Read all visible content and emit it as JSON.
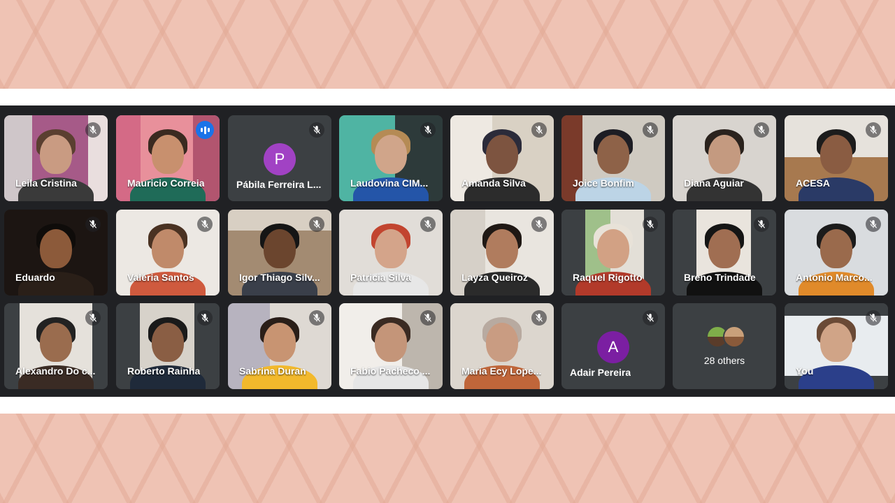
{
  "others_label": "28 others",
  "participants": [
    {
      "name": "Leila Cristina"
    },
    {
      "name": "Mauricio Correia"
    },
    {
      "name": "Pábila Ferreira L...",
      "avatar_letter": "P",
      "avatar_color": "#a142c4"
    },
    {
      "name": "Laudovina CIM..."
    },
    {
      "name": "Amanda Silva"
    },
    {
      "name": "Joice Bonfim"
    },
    {
      "name": "Diana Aguiar"
    },
    {
      "name": "ACESA"
    },
    {
      "name": "Eduardo"
    },
    {
      "name": "Valéria Santos"
    },
    {
      "name": "Igor Thiago Silv..."
    },
    {
      "name": "Patricia Silva"
    },
    {
      "name": "Layza Queiroz"
    },
    {
      "name": "Raquel Rigotto"
    },
    {
      "name": "Breno Trindade"
    },
    {
      "name": "Antonio Marco..."
    },
    {
      "name": "Alexandro Do c..."
    },
    {
      "name": "Roberto Rainha"
    },
    {
      "name": "Sabrina Duran"
    },
    {
      "name": "Fabio Pacheco ..."
    },
    {
      "name": "Maria Ecy Lope..."
    },
    {
      "name": "Adair Pereira",
      "avatar_letter": "A",
      "avatar_color": "#7b1fa2"
    },
    {
      "name": "You"
    }
  ],
  "colors": {
    "meet_background": "#202124",
    "tile_background": "#3c4043",
    "active_speaker_border": "#8ab4f8",
    "page_background": "#efc3b4"
  },
  "icons": {
    "muted": "mic-off-icon",
    "speaking": "audio-level-icon"
  }
}
